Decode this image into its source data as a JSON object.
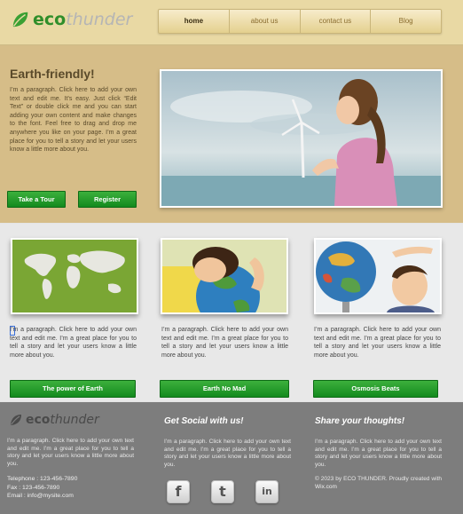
{
  "logo": {
    "eco": "eco",
    "thunder": "thunder"
  },
  "nav": [
    {
      "label": "home",
      "active": true
    },
    {
      "label": "about us",
      "active": false
    },
    {
      "label": "contact us",
      "active": false
    },
    {
      "label": "Blog",
      "active": false
    }
  ],
  "hero": {
    "title": "Earth-friendly!",
    "paragraph": "I’m a paragraph. Click here to add your own text and edit me. It’s easy. Just click “Edit Text” or double click me and you can start adding your own content and make changes to the font. Feel free to drag and drop me anywhere you like on your page. I’m a great place for you to tell a story and let your users know a little more about you.",
    "tour_button": "Take a Tour",
    "register_button": "Register"
  },
  "features": [
    {
      "text": "I’m a paragraph. Click here to add your own text and edit me. I’m a great place for you to tell a story and let your users know a little more about you.",
      "button": "The power of Earth"
    },
    {
      "text": "I’m a paragraph. Click here to add your own text and edit me. I’m a great place for you to tell a story and let your users know a little more about you.",
      "button": "Earth No Mad"
    },
    {
      "text": "I’m a paragraph. Click here to add your own text and edit me. I’m a great place for you to tell a story and let your users know a little more about you.",
      "button": "Osmosis Beats"
    }
  ],
  "footer": {
    "col1_text": "I’m a paragraph. Click here to add your own text and edit me. I’m a great place for you to tell a story and let your users know a little more about you.",
    "telephone": "Telephone : 123-456-7890",
    "fax": "Fax : 123-456-7890",
    "email": "Email : info@mysite.com",
    "social_heading": "Get Social with us!",
    "social_text": "I’m a paragraph. Click here to add your own text and edit me. I’m a great place for you to tell a story and let your users know a little more about you.",
    "share_heading": "Share your thoughts!",
    "share_text": "I’m a paragraph. Click here to add your own text and edit me. I’m a great place for you to tell a story and let your users know a little more about you.",
    "copyright": "© 2023 by ECO THUNDER. Proudly created with",
    "wix_link": "Wix.com",
    "social_icons": [
      {
        "name": "facebook-icon",
        "glyph": "f"
      },
      {
        "name": "twitter-icon",
        "glyph": "t"
      },
      {
        "name": "linkedin-icon",
        "glyph": "in"
      }
    ]
  },
  "colors": {
    "green": "#1f9a26",
    "tan": "#d6bd88",
    "footer": "#7d7d7d"
  }
}
